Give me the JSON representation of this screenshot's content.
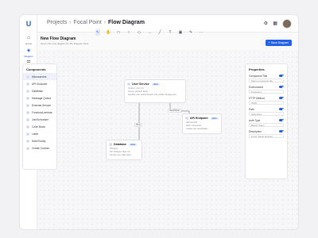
{
  "rail": {
    "items": [
      {
        "label": "Home",
        "icon": "home-icon",
        "glyph": "⌂"
      },
      {
        "label": "Diagram",
        "icon": "diagram-icon",
        "glyph": "◈",
        "active": true
      },
      {
        "label": "Task",
        "icon": "task-icon",
        "glyph": "☰"
      },
      {
        "label": "",
        "icon": "arrow-icon",
        "glyph": "↕"
      },
      {
        "label": "Menu",
        "icon": "menu-icon",
        "glyph": "≡"
      },
      {
        "label": "Notification",
        "icon": "bell-icon",
        "glyph": "♪"
      },
      {
        "label": "Search",
        "icon": "search-icon",
        "glyph": "⌕"
      }
    ],
    "logo": "U"
  },
  "breadcrumb": {
    "items": [
      "Projects",
      "Focal Point",
      "Flow Diagram"
    ]
  },
  "header": {
    "title": "New Flow Diagram",
    "subtitle": "Here's the new diagram for the Diagram Flow",
    "save_label": "Save Diagram"
  },
  "components": {
    "title": "Components",
    "items": [
      {
        "label": "Microservice",
        "active": true
      },
      {
        "label": "API Endpoint"
      },
      {
        "label": "Database"
      },
      {
        "label": "Message Queue"
      },
      {
        "label": "External Service"
      },
      {
        "label": "Function/Lambda"
      },
      {
        "label": "Job/Scheduler"
      },
      {
        "label": "Code Block"
      },
      {
        "label": "Label"
      },
      {
        "label": "Note/Tooltip"
      },
      {
        "label": "Create Custom"
      }
    ]
  },
  "properties": {
    "title": "Properties",
    "fields": [
      {
        "label": "Component Title",
        "value": "Name component title",
        "toggle": true
      },
      {
        "label": "Environment",
        "value": "Production",
        "toggle": true
      },
      {
        "label": "HTTP Method",
        "value": "POST",
        "toggle": true
      },
      {
        "label": "Path",
        "value": "/api/orders",
        "toggle": true
      },
      {
        "label": "Auth Type",
        "value": "Bearer Token",
        "toggle": true
      },
      {
        "label": "Description",
        "value": "Lorem ipsum sit amet",
        "toggle": true
      }
    ]
  },
  "nodes": {
    "user_service": {
      "title": "User Service",
      "tag": "NEW",
      "lines": [
        "Version: v1.0.1.0",
        "Owner: Product Team",
        "Handles user authentication and profile management"
      ]
    },
    "api_endpoint": {
      "title": "API Endpoint",
      "tag": "NEW",
      "lines": [
        "/api/users/id",
        "Path: /v1/user/id",
        "Create new user/profile"
      ]
    },
    "database": {
      "title": "Database",
      "tag": "NEW",
      "lines": [
        "Postgres",
        "Db: Postgres SQL v14",
        "Primary user data store"
      ]
    }
  },
  "edges": {
    "e1": "Write",
    "e2": "Read/Write"
  }
}
